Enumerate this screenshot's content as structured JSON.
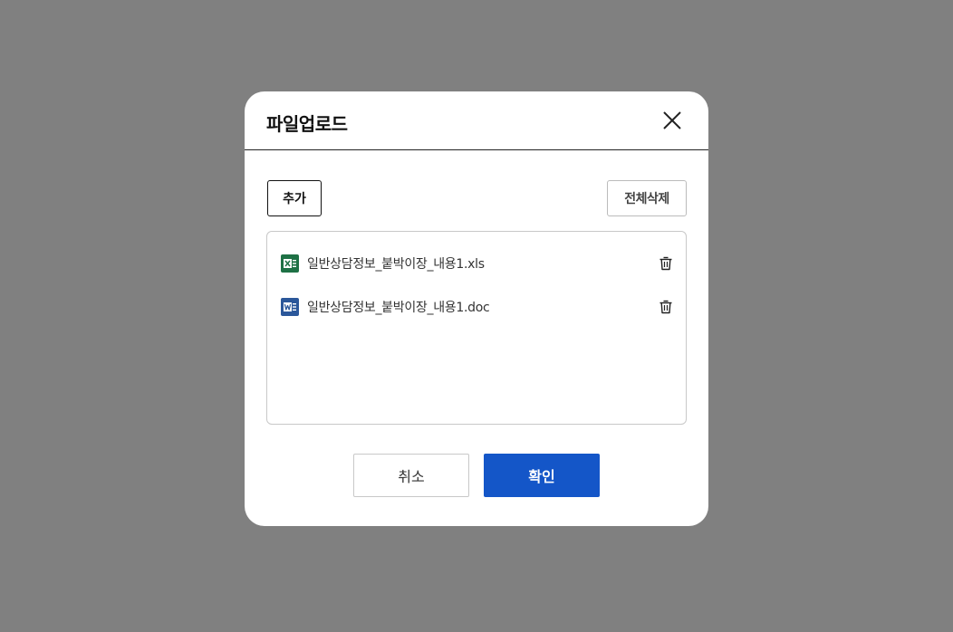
{
  "dialog": {
    "title": "파일업로드",
    "close_icon": "close-icon"
  },
  "toolbar": {
    "add_label": "추가",
    "delete_all_label": "전체삭제"
  },
  "files": [
    {
      "name": "일반상담정보_붙박이장_내용1.xls",
      "type": "excel",
      "icon": "excel-file-icon",
      "color": "#1e7145"
    },
    {
      "name": "일반상담정보_붙박이장_내용1.doc",
      "type": "word",
      "icon": "word-file-icon",
      "color": "#2b579a"
    }
  ],
  "footer": {
    "cancel_label": "취소",
    "confirm_label": "확인"
  },
  "colors": {
    "overlay": "#808080",
    "primary": "#1456c8"
  }
}
